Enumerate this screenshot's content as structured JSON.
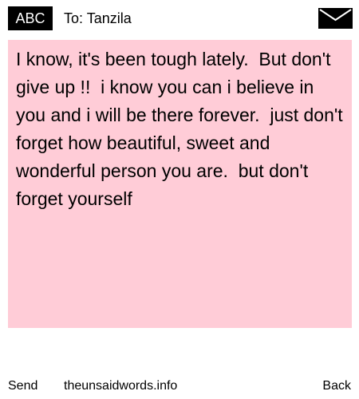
{
  "header": {
    "input_mode": "ABC",
    "recipient": "To: Tanzila",
    "mail_icon": "envelope-icon"
  },
  "message": {
    "body": "I know, it's been tough lately.  But don't give up !!  i know you can i believe in you and i will be there forever.  just don't forget how beautiful, sweet and wonderful person you are.  but don't forget yourself"
  },
  "footer": {
    "send_label": "Send",
    "site_label": "theunsaidwords.info",
    "back_label": "Back"
  },
  "colors": {
    "message_background": "#ffccd7",
    "badge_background": "#000000",
    "badge_text": "#ffffff"
  }
}
